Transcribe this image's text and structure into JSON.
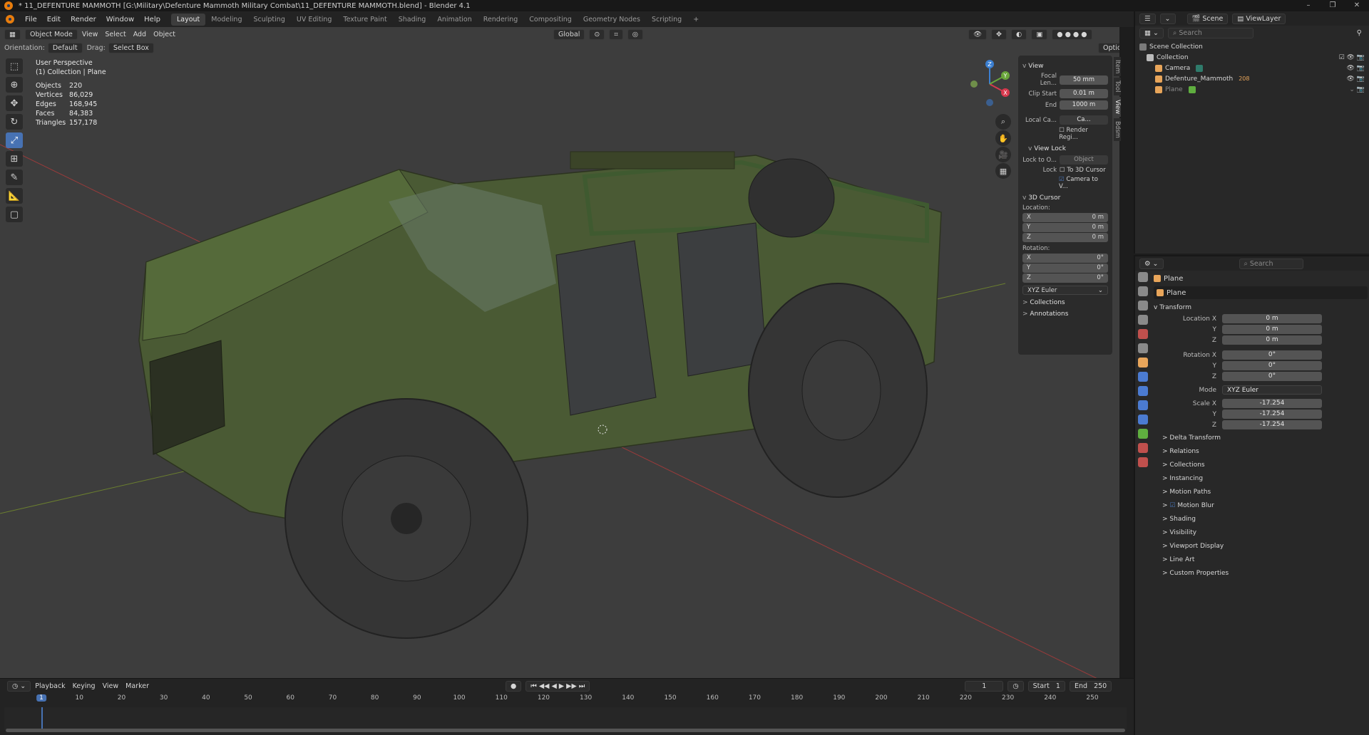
{
  "window": {
    "title": "* 11_DEFENTURE MAMMOTH [G:\\Military\\Defenture Mammoth Military Combat\\11_DEFENTURE MAMMOTH.blend] - Blender 4.1",
    "controls": [
      "–",
      "❐",
      "✕"
    ]
  },
  "menu": [
    "File",
    "Edit",
    "Render",
    "Window",
    "Help"
  ],
  "workspaces": [
    "Layout",
    "Modeling",
    "Sculpting",
    "UV Editing",
    "Texture Paint",
    "Shading",
    "Animation",
    "Rendering",
    "Compositing",
    "Geometry Nodes",
    "Scripting"
  ],
  "add_workspace": "+",
  "topright": {
    "scene": "Scene",
    "view_layer": "ViewLayer"
  },
  "viewport": {
    "mode": "Object Mode",
    "menus": [
      "View",
      "Select",
      "Add",
      "Object"
    ],
    "transform_orientation": "Global",
    "options": "Options",
    "orientation_label": "Orientation:",
    "orientation_value": "Default",
    "drag_label": "Drag:",
    "drag_value": "Select Box",
    "perspective": "User Perspective",
    "collection": "(1) Collection | Plane",
    "stats": [
      {
        "k": "Objects",
        "v": "220"
      },
      {
        "k": "Vertices",
        "v": "86,029"
      },
      {
        "k": "Edges",
        "v": "168,945"
      },
      {
        "k": "Faces",
        "v": "84,383"
      },
      {
        "k": "Triangles",
        "v": "157,178"
      }
    ],
    "gizmo": {
      "x": "X",
      "y": "Y",
      "z": "Z"
    }
  },
  "npanel": {
    "tabs": [
      "Item",
      "Tool",
      "View",
      "Bdsm"
    ],
    "view": {
      "title": "View",
      "focal_label": "Focal Len...",
      "focal": "50 mm",
      "clip_start_label": "Clip Start",
      "clip_start": "0.01 m",
      "end_label": "End",
      "end": "1000 m",
      "local_label": "Local Ca...",
      "local_value": "Ca...",
      "render_region": "Render Regi..."
    },
    "view_lock": {
      "title": "View Lock",
      "lock_to_label": "Lock to O...",
      "lock_to_value": "Object",
      "lock_label": "Lock",
      "to_cursor": "To 3D Cursor",
      "camera_to_view": "Camera to V..."
    },
    "cursor": {
      "title": "3D Cursor",
      "location_label": "Location:",
      "loc": [
        {
          "a": "X",
          "v": "0 m"
        },
        {
          "a": "Y",
          "v": "0 m"
        },
        {
          "a": "Z",
          "v": "0 m"
        }
      ],
      "rotation_label": "Rotation:",
      "rot": [
        {
          "a": "X",
          "v": "0°"
        },
        {
          "a": "Y",
          "v": "0°"
        },
        {
          "a": "Z",
          "v": "0°"
        }
      ],
      "mode": "XYZ Euler"
    },
    "collections": "Collections",
    "annotations": "Annotations"
  },
  "outliner": {
    "search": "Search",
    "items": [
      {
        "label": "Scene Collection",
        "indent": 0,
        "color": "#aaaaaa"
      },
      {
        "label": "Collection",
        "indent": 1,
        "color": "#cfcfcf"
      },
      {
        "label": "Camera",
        "indent": 2,
        "color": "#e8a55a"
      },
      {
        "label": "Defenture_Mammoth",
        "indent": 2,
        "color": "#e8a55a"
      },
      {
        "label": "Plane",
        "indent": 2,
        "color": "#e8a55a"
      }
    ],
    "mammoth_count": "208"
  },
  "properties": {
    "search": "Search",
    "object_name": "Plane",
    "data_name": "Plane",
    "transform_title": "Transform",
    "location": [
      {
        "l": "Location X",
        "v": "0 m"
      },
      {
        "l": "Y",
        "v": "0 m"
      },
      {
        "l": "Z",
        "v": "0 m"
      }
    ],
    "rotation": [
      {
        "l": "Rotation X",
        "v": "0°"
      },
      {
        "l": "Y",
        "v": "0°"
      },
      {
        "l": "Z",
        "v": "0°"
      }
    ],
    "mode_label": "Mode",
    "mode_value": "XYZ Euler",
    "scale": [
      {
        "l": "Scale X",
        "v": "-17.254"
      },
      {
        "l": "Y",
        "v": "-17.254"
      },
      {
        "l": "Z",
        "v": "-17.254"
      }
    ],
    "delta": "Delta Transform",
    "sections": [
      "Relations",
      "Collections",
      "Instancing",
      "Motion Paths",
      "Motion Blur",
      "Shading",
      "Visibility",
      "Viewport Display",
      "Line Art",
      "Custom Properties"
    ]
  },
  "timeline": {
    "menus": [
      "Playback",
      "Keying",
      "View",
      "Marker"
    ],
    "current_frame": "1",
    "start_label": "Start",
    "start": "1",
    "end_label": "End",
    "end": "250",
    "ticks": [
      "1",
      "10",
      "20",
      "30",
      "40",
      "50",
      "60",
      "70",
      "80",
      "90",
      "100",
      "110",
      "120",
      "130",
      "140",
      "150",
      "160",
      "170",
      "180",
      "190",
      "200",
      "210",
      "220",
      "230",
      "240",
      "250"
    ]
  }
}
